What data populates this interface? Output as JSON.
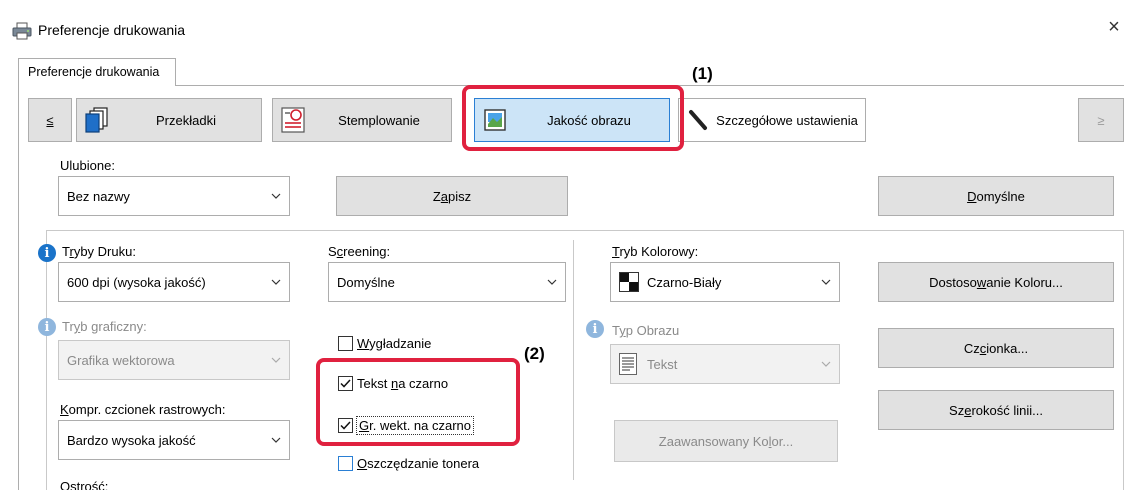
{
  "window": {
    "title": "Preferencje drukowania",
    "close_glyph": "×",
    "icon": "printer-icon"
  },
  "tabs": [
    {
      "label": "Preferencje drukowania",
      "selected": true
    }
  ],
  "toolbar": {
    "prev_label": "≤",
    "next_label": "≥",
    "buttons": [
      {
        "label": "Przekładki",
        "icon": "pages-icon"
      },
      {
        "label": "Stemplowanie",
        "icon": "stamp-icon"
      },
      {
        "label": "Jakość obrazu",
        "icon": "image-quality-icon",
        "selected": true
      },
      {
        "label": "Szczegółowe ustawienia",
        "icon": "wrench-icon"
      }
    ]
  },
  "favorites": {
    "label": "Ulubione:",
    "value": "Bez nazwy",
    "save_label_pre": "Z",
    "save_label_u": "a",
    "save_label_post": "pisz",
    "defaults_label_u": "D",
    "defaults_label_post": "omyślne"
  },
  "print_modes": {
    "label_pre": "T",
    "label_u": "r",
    "label_post": "yby Druku:",
    "value": "600 dpi (wysoka jakość)"
  },
  "graphics_mode": {
    "label_pre": "Tr",
    "label_u": "y",
    "label_post": "b graficzny:",
    "value": "Grafika wektorowa",
    "enabled": false
  },
  "raster_font": {
    "label_u": "K",
    "label_post": "ompr. czcionek rastrowych:",
    "value": "Bardzo wysoka jakość"
  },
  "sharpness": {
    "label": "Ostrość:"
  },
  "screening": {
    "label_pre": "S",
    "label_u": "c",
    "label_post": "reening:",
    "value": "Domyślne"
  },
  "checkboxes": {
    "smoothing": {
      "label_pre": "",
      "label_u": "W",
      "label_post": "ygładzanie",
      "checked": false
    },
    "text_black": {
      "label_pre": "Tekst ",
      "label_u": "n",
      "label_post": "a czarno",
      "checked": true
    },
    "vector_black": {
      "label_pre": "",
      "label_u": "G",
      "label_post": "r. wekt. na czarno",
      "checked": true
    },
    "toner_save": {
      "label_pre": "",
      "label_u": "O",
      "label_post": "szczędzanie tonera",
      "checked": false
    }
  },
  "color_mode": {
    "label_u": "T",
    "label_post": "ryb Kolorowy:",
    "value": "Czarno-Biały"
  },
  "image_type": {
    "label_pre": "T",
    "label_u": "y",
    "label_post": "p Obrazu",
    "value": "Tekst",
    "enabled": false
  },
  "advanced_color": {
    "label_pre": "Zaawansowany Ko",
    "label_u": "l",
    "label_post": "or...",
    "enabled": false
  },
  "side_buttons": {
    "color_adjust": {
      "label_pre": "Dostoso",
      "label_u": "w",
      "label_post": "anie Koloru..."
    },
    "font": {
      "label_pre": "Cz",
      "label_u": "c",
      "label_post": "ionka..."
    },
    "line_width": {
      "label_pre": "Sz",
      "label_u": "e",
      "label_post": "rokość linii..."
    }
  },
  "callouts": {
    "one": "(1)",
    "two": "(2)"
  },
  "colors": {
    "callout": "#e0213f",
    "selected_bg": "#cce4f7",
    "selected_border": "#2a7fd4",
    "info": "#1a73c9"
  }
}
